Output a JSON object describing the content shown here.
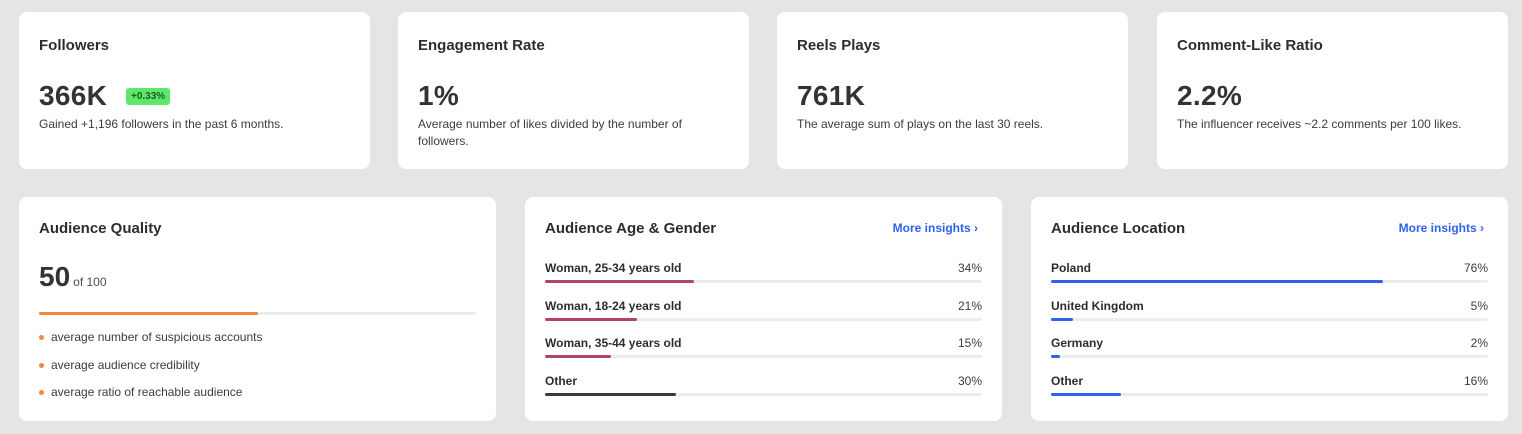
{
  "stats": [
    {
      "title": "Followers",
      "value": "366K",
      "badge": "+0.33%",
      "desc": "Gained +1,196 followers in the past 6 months."
    },
    {
      "title": "Engagement Rate",
      "value": "1%",
      "desc": "Average number of likes divided by the number of followers."
    },
    {
      "title": "Reels Plays",
      "value": "761K",
      "desc": "The average sum of plays on the last 30 reels."
    },
    {
      "title": "Comment-Like Ratio",
      "value": "2.2%",
      "desc": "The influencer receives ~2.2 comments per 100 likes."
    }
  ],
  "quality": {
    "title": "Audience Quality",
    "score": "50",
    "of": "of 100",
    "progress": 0.5,
    "bullets": [
      "average number of suspicious accounts",
      "average audience credibility",
      "average ratio of reachable audience"
    ]
  },
  "age_gender": {
    "title": "Audience Age & Gender",
    "more": "More insights ›",
    "rows": [
      {
        "label": "Woman, 25-34 years old",
        "pct": "34%",
        "value": 0.34,
        "color": "#b5426e"
      },
      {
        "label": "Woman, 18-24 years old",
        "pct": "21%",
        "value": 0.21,
        "color": "#b5426e"
      },
      {
        "label": "Woman, 35-44 years old",
        "pct": "15%",
        "value": 0.15,
        "color": "#b5426e"
      },
      {
        "label": "Other",
        "pct": "30%",
        "value": 0.3,
        "color": "#3a3b3d"
      }
    ]
  },
  "location": {
    "title": "Audience Location",
    "more": "More insights ›",
    "rows": [
      {
        "label": "Poland",
        "pct": "76%",
        "value": 0.76,
        "color": "#2f62e8"
      },
      {
        "label": "United Kingdom",
        "pct": "5%",
        "value": 0.05,
        "color": "#2f62e8"
      },
      {
        "label": "Germany",
        "pct": "2%",
        "value": 0.02,
        "color": "#2f62e8"
      },
      {
        "label": "Other",
        "pct": "16%",
        "value": 0.16,
        "color": "#2f62e8"
      }
    ]
  }
}
